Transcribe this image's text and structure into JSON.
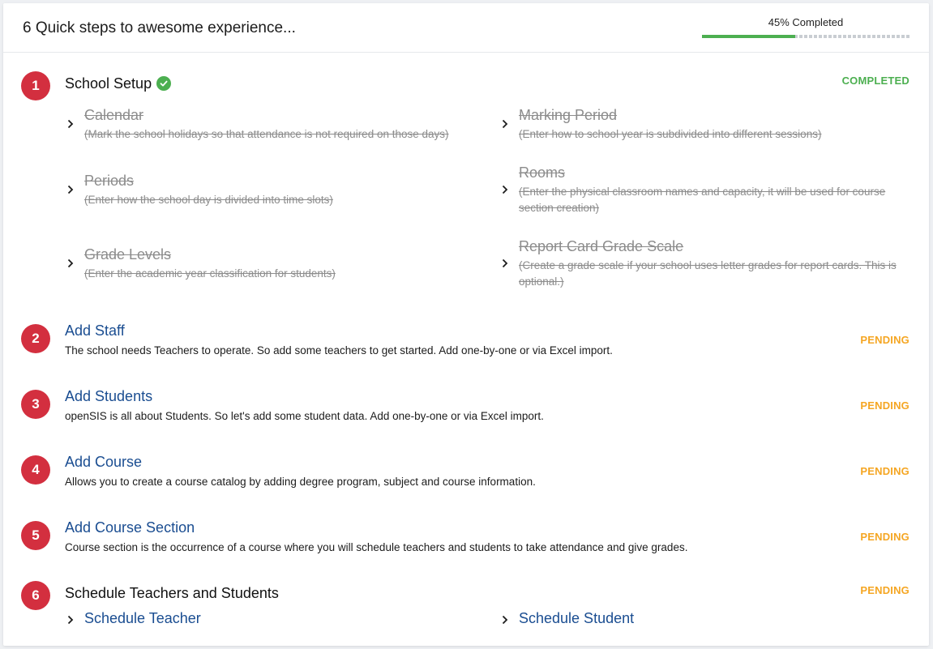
{
  "header": {
    "title": "6 Quick steps to awesome experience...",
    "progress_label": "45% Completed",
    "progress_fraction": 0.45
  },
  "colors": {
    "accent_red": "#d32f3f",
    "link_blue": "#1a4d91",
    "completed_green": "#4caf50",
    "pending_orange": "#f5a623"
  },
  "steps": [
    {
      "number": "1",
      "title": "School Setup",
      "status": "COMPLETED",
      "icon": "check-circle-icon",
      "substeps": [
        {
          "title": "Calendar",
          "desc": "(Mark the school holidays so that attendance is not required on those days)"
        },
        {
          "title": "Marking Period",
          "desc": "(Enter how to school year is subdivided into different sessions)"
        },
        {
          "title": "Periods",
          "desc": "(Enter how the school day is divided into time slots)"
        },
        {
          "title": "Rooms",
          "desc": "(Enter the physical classroom names and capacity, it will be used for course section creation)"
        },
        {
          "title": "Grade Levels",
          "desc": "(Enter the academic year classification for students)"
        },
        {
          "title": "Report Card Grade Scale",
          "desc": "(Create a grade scale if your school uses letter grades for report cards. This is optional.)"
        }
      ]
    },
    {
      "number": "2",
      "title": "Add Staff",
      "status": "PENDING",
      "desc": "The school needs Teachers to operate. So add some teachers to get started. Add one-by-one or via Excel import."
    },
    {
      "number": "3",
      "title": "Add Students",
      "status": "PENDING",
      "desc": "openSIS is all about Students. So let's add some student data. Add one-by-one or via Excel import."
    },
    {
      "number": "4",
      "title": "Add Course",
      "status": "PENDING",
      "desc": "Allows you to create a course catalog by adding degree program, subject and course information."
    },
    {
      "number": "5",
      "title": "Add Course Section",
      "status": "PENDING",
      "desc": "Course section is the occurrence of a course where you will schedule teachers and students to take attendance and give grades."
    },
    {
      "number": "6",
      "title": "Schedule Teachers and Students",
      "status": "PENDING",
      "links": [
        "Schedule Teacher",
        "Schedule Student"
      ]
    }
  ]
}
